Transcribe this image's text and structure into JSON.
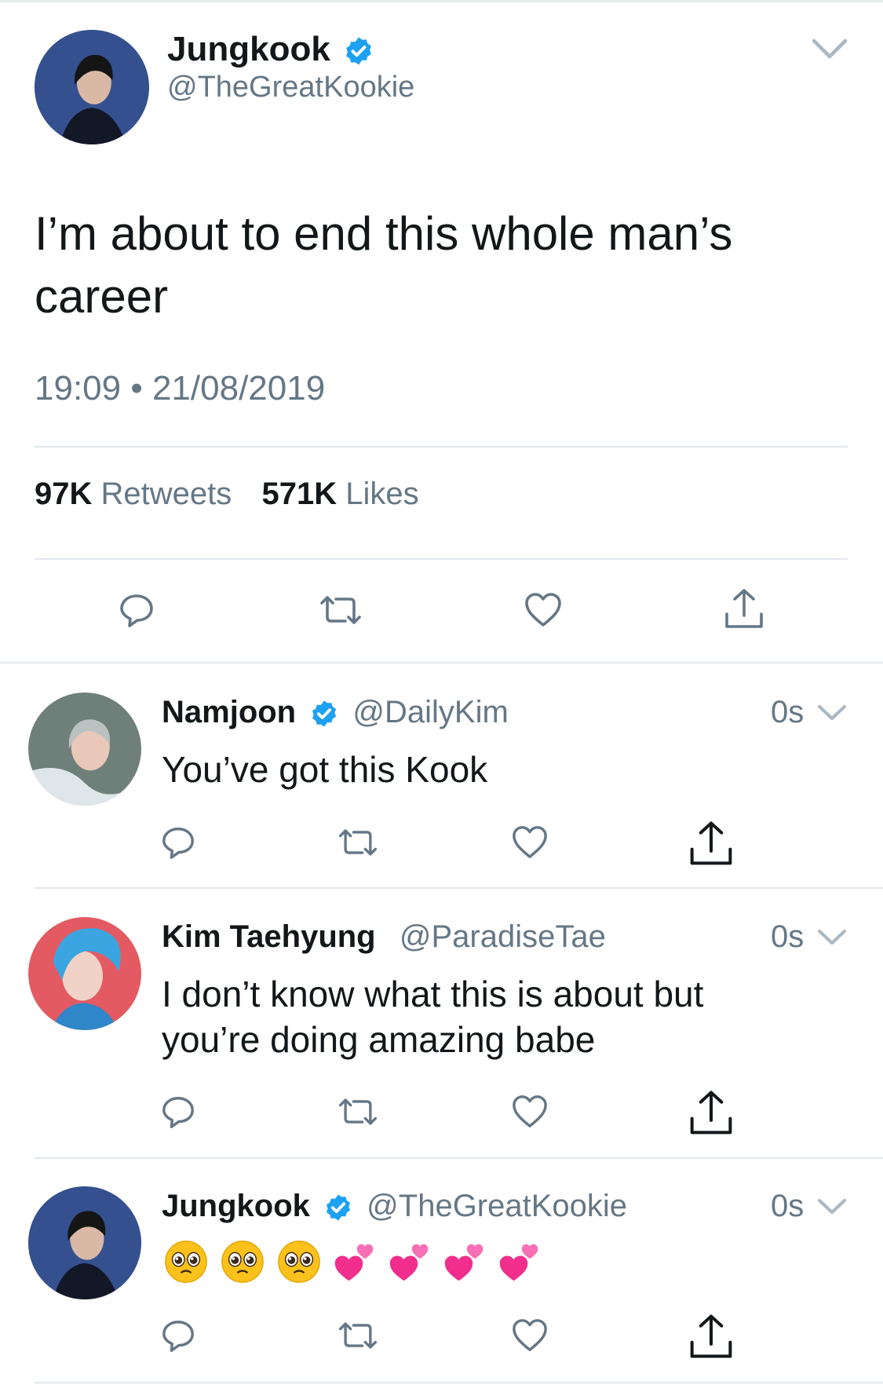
{
  "tweet": {
    "author": {
      "name": "Jungkook",
      "handle": "@TheGreatKookie",
      "verified": true
    },
    "text": "I’m about to end this whole man’s career",
    "timestamp": "19:09 • 21/08/2019",
    "stats": {
      "retweets_count": "97K",
      "retweets_label": "Retweets",
      "likes_count": "571K",
      "likes_label": "Likes"
    },
    "actions": [
      "reply-icon",
      "retweet-icon",
      "like-icon",
      "share-icon"
    ]
  },
  "replies": [
    {
      "name": "Namjoon",
      "handle": "@DailyKim",
      "verified": true,
      "time": "0s",
      "text": "You’ve got this Kook"
    },
    {
      "name": "Kim Taehyung",
      "handle": "@ParadiseTae",
      "verified": false,
      "time": "0s",
      "text_line1": "I don’t know what this is about but",
      "text_line2": "you’re doing amazing babe"
    },
    {
      "name": "Jungkook",
      "handle": "@TheGreatKookie",
      "verified": true,
      "time": "0s",
      "emojis": [
        "pleading-face",
        "pleading-face",
        "pleading-face",
        "two-hearts",
        "two-hearts",
        "two-hearts",
        "two-hearts"
      ]
    }
  ],
  "colors": {
    "verified": "#1da1f2",
    "muted": "#657786",
    "divider": "#e1e8ed",
    "heart": "#f12e8c"
  }
}
